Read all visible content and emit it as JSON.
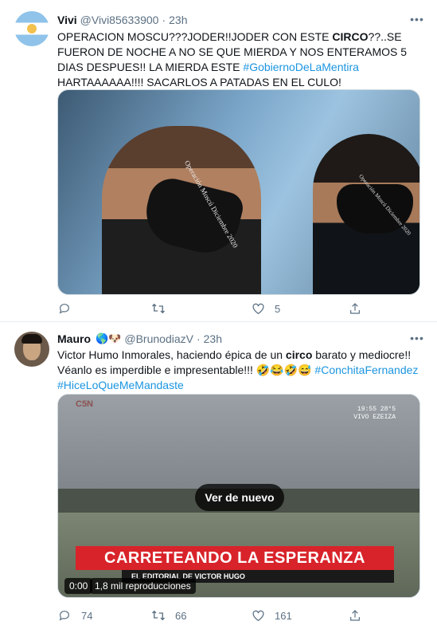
{
  "tweets": [
    {
      "name": "Vivi",
      "handle": "@Vivi85633900",
      "separator": "·",
      "time": "23h",
      "more": "•••",
      "text_parts": [
        "OPERACION MOSCU???JODER!!JODER CON ESTE ",
        "CIRCO",
        "??..SE FUERON DE NOCHE A NO SE QUE MIERDA Y NOS ENTERAMOS 5 DIAS DESPUES!! LA MIERDA ESTE ",
        "#GobiernoDeLaMentira",
        " HARTAAAAAA!!!! SACARLOS A PATADAS EN EL CULO!"
      ],
      "mask_text_1": "Operación Moscú Diciembre 2020",
      "mask_text_2": "Operación Moscú Diciembre 2020",
      "actions": {
        "reply_count": "",
        "retweet_count": "",
        "like_count": "5"
      }
    },
    {
      "name": "Mauro",
      "emojis": "🌎🐶",
      "handle": "@BrunodiazV",
      "separator": "·",
      "time": "23h",
      "more": "•••",
      "text_parts": [
        "Victor Humo Inmorales, haciendo épica de un ",
        "circo",
        " barato y mediocre!! Véanlo es imperdible e impresentable!!! 🤣😂🤣😅 ",
        "#ConchitaFernandez",
        "#HiceLoQueMeMandaste"
      ],
      "video": {
        "channel_logo": "C5N",
        "clock": "19:55  28°5",
        "clock_place": "VIVO EZEIZA",
        "banner": "CARRETEANDO LA ESPERANZA",
        "subtitle": "EL EDITORIAL DE VICTOR HUGO",
        "replay_label": "Ver de nuevo",
        "elapsed": "0:00",
        "views": "1,8 mil reproducciones"
      },
      "actions": {
        "reply_count": "74",
        "retweet_count": "66",
        "like_count": "161"
      }
    }
  ],
  "icons": {
    "reply": "reply-icon",
    "retweet": "retweet-icon",
    "like": "heart-icon",
    "share": "share-icon",
    "more": "more-icon"
  },
  "colors": {
    "link": "#1b95e0",
    "secondary": "#5b7083",
    "divider": "#e6ecf0",
    "banner": "#d8232a"
  }
}
